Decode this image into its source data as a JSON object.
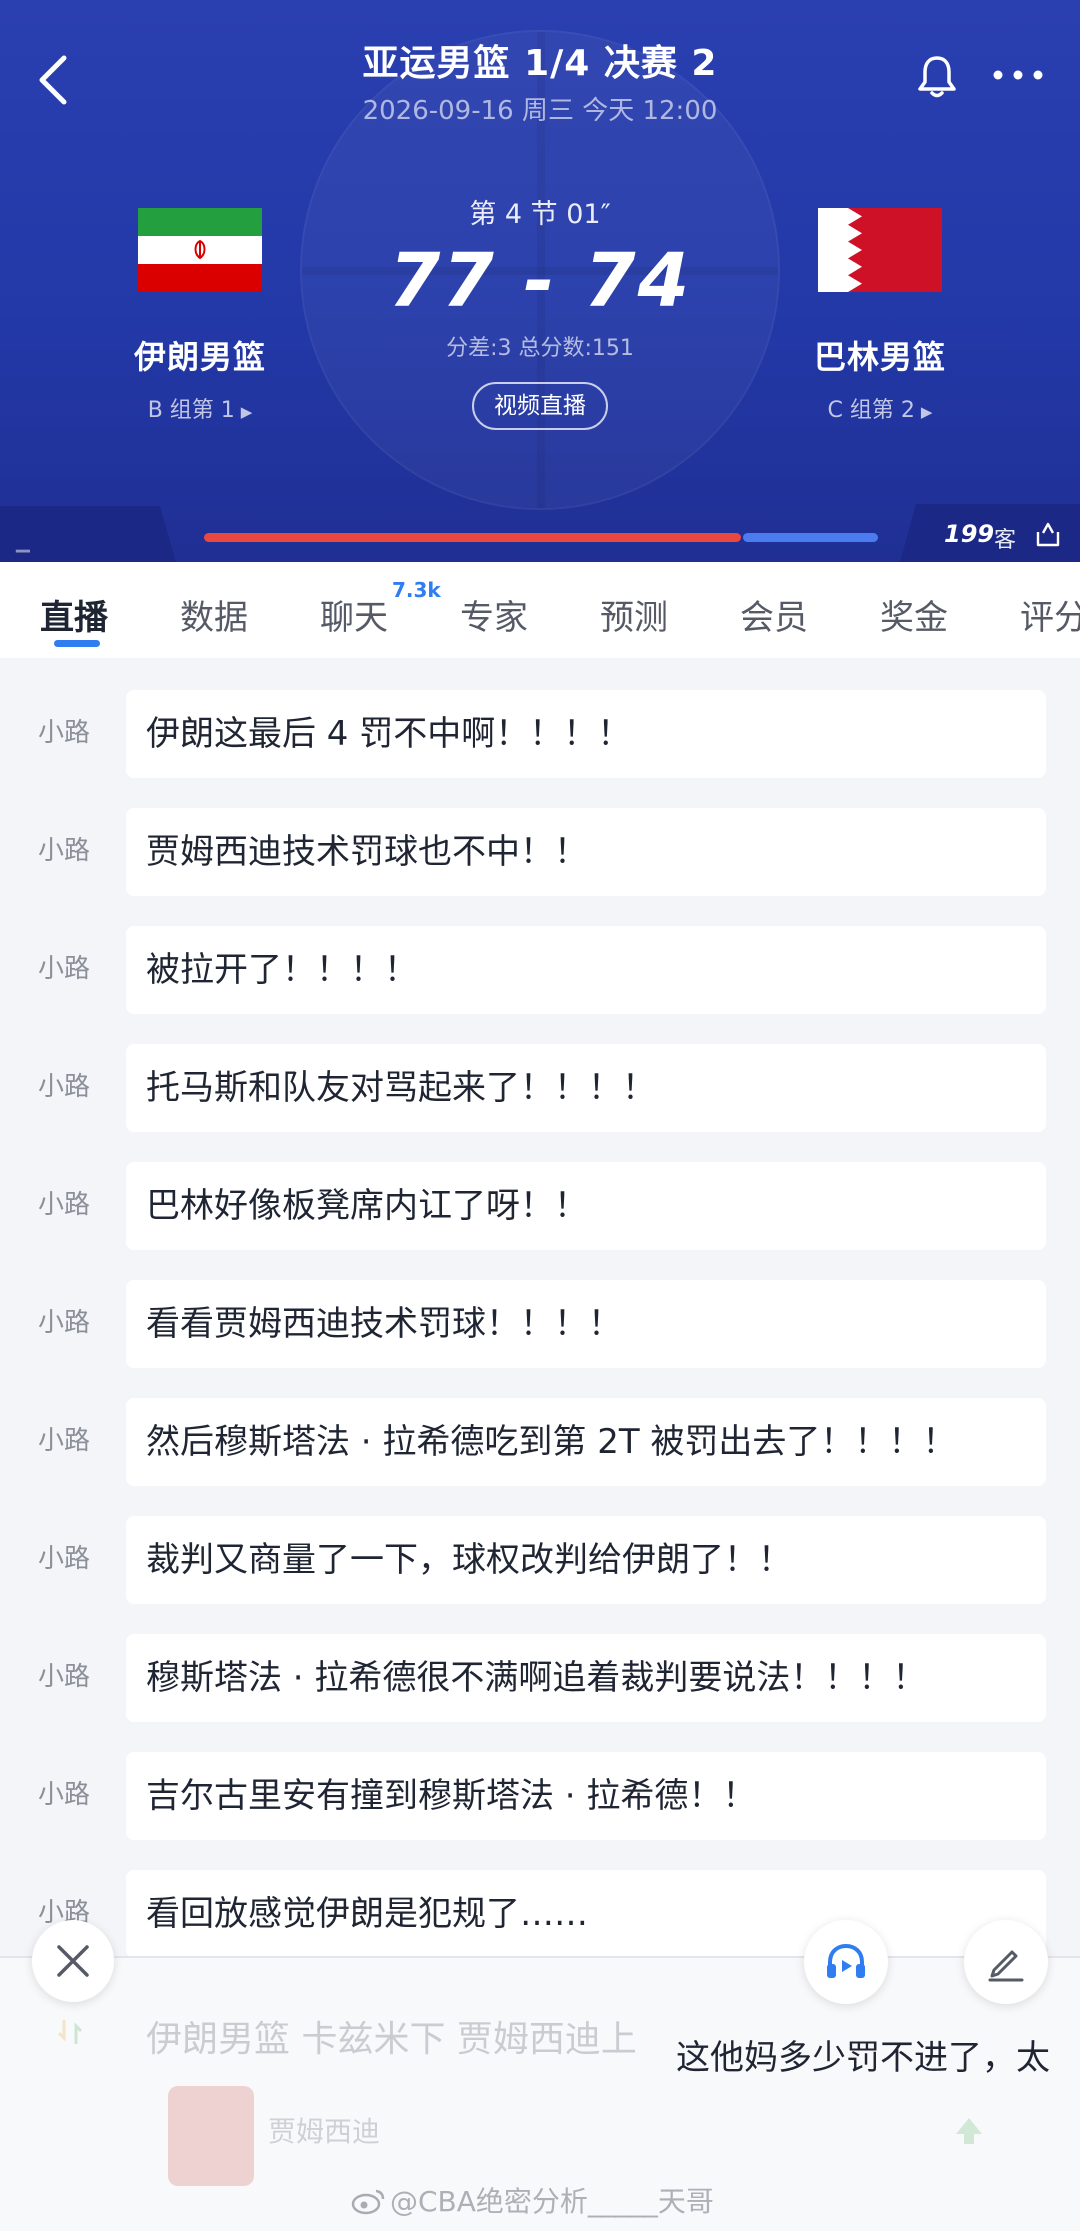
{
  "header": {
    "title": "亚运男篮 1/4 决赛 2",
    "datetime": "2026-09-16 周三 今天 12:00",
    "period_clock": "第 4 节 01″",
    "score": "77 - 74",
    "score_detail": "分差:3 总分数:151",
    "video_button": "视频直播",
    "home": {
      "name": "伊朗男篮",
      "rank": "B 组第 1",
      "flag": "iran-flag"
    },
    "away": {
      "name": "巴林男篮",
      "rank": "C 组第 2",
      "flag": "bahrain-flag"
    },
    "viewers": "199",
    "guest_label": "客",
    "home_share": 0.8,
    "colors": {
      "home_bar": "#e9473f",
      "away_bar": "#4a7cf0",
      "bg": "#2339a8"
    }
  },
  "tabs": [
    {
      "label": "直播",
      "active": true
    },
    {
      "label": "数据"
    },
    {
      "label": "聊天",
      "badge": "7.3k"
    },
    {
      "label": "专家"
    },
    {
      "label": "预测"
    },
    {
      "label": "会员"
    },
    {
      "label": "奖金"
    },
    {
      "label": "评分"
    }
  ],
  "feed": [
    {
      "author": "小路",
      "text": "伊朗这最后 4 罚不中啊！！！！"
    },
    {
      "author": "小路",
      "text": "贾姆西迪技术罚球也不中！！"
    },
    {
      "author": "小路",
      "text": "被拉开了！！！！"
    },
    {
      "author": "小路",
      "text": "托马斯和队友对骂起来了！！！！"
    },
    {
      "author": "小路",
      "text": "巴林好像板凳席内讧了呀！！"
    },
    {
      "author": "小路",
      "text": "看看贾姆西迪技术罚球！！！！"
    },
    {
      "author": "小路",
      "text": "然后穆斯塔法 · 拉希德吃到第 2T 被罚出去了！！！！"
    },
    {
      "author": "小路",
      "text": "裁判又商量了一下，球权改判给伊朗了！！"
    },
    {
      "author": "小路",
      "text": "穆斯塔法 · 拉希德很不满啊追着裁判要说法！！！！"
    },
    {
      "author": "小路",
      "text": "吉尔古里安有撞到穆斯塔法 · 拉希德！！"
    },
    {
      "author": "小路",
      "text": "看回放感觉伊朗是犯规了……"
    }
  ],
  "bottom": {
    "faded_event": "伊朗男篮 卡兹米下 贾姆西迪上",
    "danmaku": "这他妈多少罚不进了，太",
    "faded_player": "贾姆西迪",
    "watermark": "@CBA绝密分析_____天哥"
  }
}
